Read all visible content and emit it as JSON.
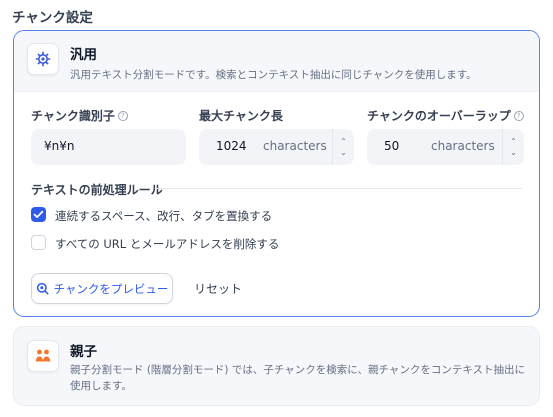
{
  "section_title": "チャンク設定",
  "general": {
    "title": "汎用",
    "description": "汎用テキスト分割モードです。検索とコンテキスト抽出に同じチャンクを使用します。",
    "fields": {
      "identifier": {
        "label": "チャンク識別子",
        "value": "¥n¥n"
      },
      "max_length": {
        "label": "最大チャンク長",
        "value": "1024",
        "unit": "characters"
      },
      "overlap": {
        "label": "チャンクのオーバーラップ",
        "value": "50",
        "unit": "characters"
      }
    },
    "rules_title": "テキストの前処理ルール",
    "rules": [
      {
        "label": "連続するスペース、改行、タブを置換する",
        "checked": true
      },
      {
        "label": "すべての URL とメールアドレスを削除する",
        "checked": false
      }
    ],
    "preview_button": "チャンクをプレビュー",
    "reset_button": "リセット"
  },
  "parent_child": {
    "title": "親子",
    "description": "親子分割モード (階層分割モード) では、子チャンクを検索に、親チャンクをコンテキスト抽出に使用します。"
  },
  "colors": {
    "accent": "#2e5be7",
    "border_active": "#5b7ff0",
    "icon_orange": "#f2762e"
  },
  "icons": {
    "general": "gear-chip-icon",
    "parent_child": "people-icon",
    "preview": "search-icon",
    "help": "help-circle-icon"
  }
}
